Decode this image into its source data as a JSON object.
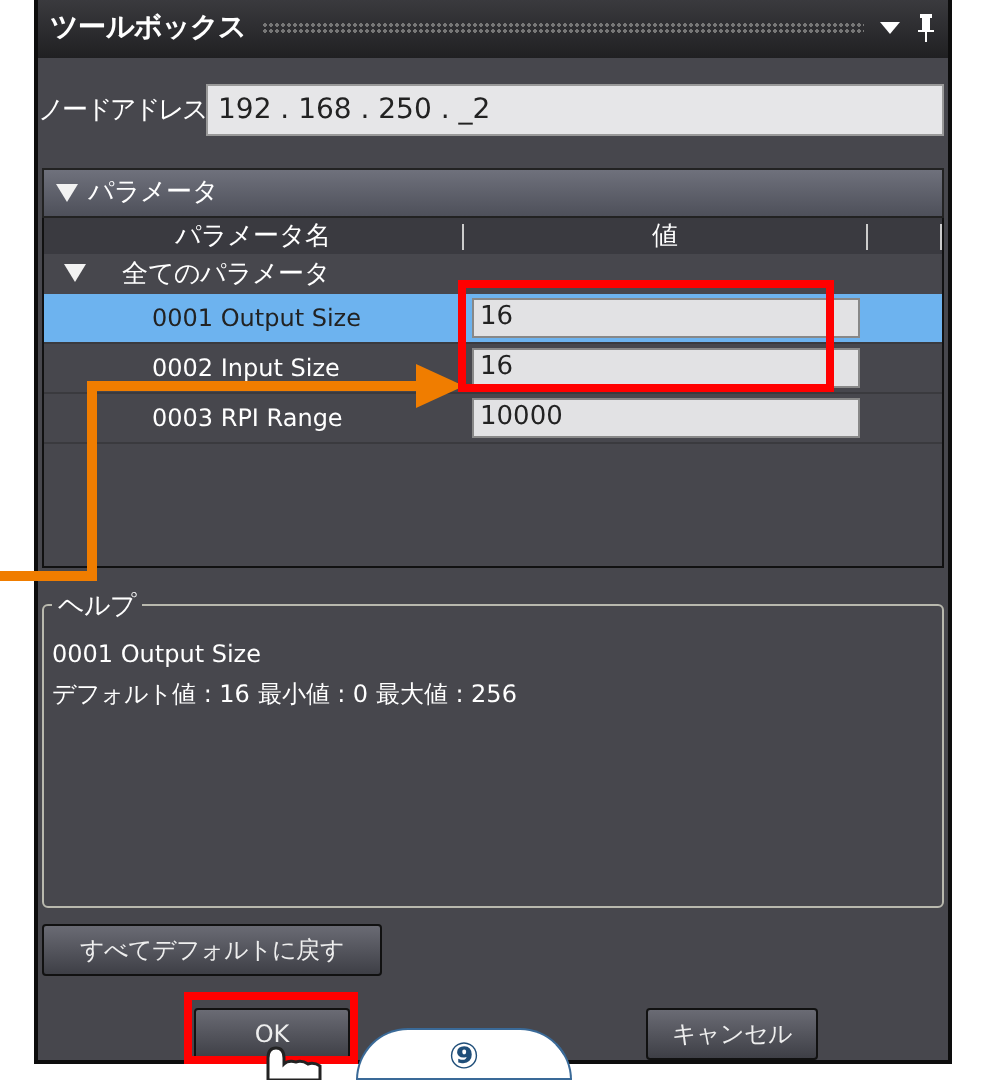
{
  "window": {
    "title": "ツールボックス"
  },
  "node_address": {
    "label": "ノードアドレス",
    "value": "192 . 168 . 250 . _2"
  },
  "parameters": {
    "title": "パラメータ",
    "expanded": true,
    "columns": [
      "パラメータ名",
      "値"
    ],
    "group": {
      "label": "全てのパラメータ",
      "expanded": true
    },
    "rows": [
      {
        "name": "0001 Output Size",
        "value": "16",
        "selected": true
      },
      {
        "name": "0002 Input Size",
        "value": "16",
        "selected": false
      },
      {
        "name": "0003 RPI Range",
        "value": "10000",
        "selected": false
      }
    ]
  },
  "help": {
    "title": "ヘルプ",
    "lines": [
      "0001 Output Size",
      "デフォルト値 : 16  最小値 : 0  最大値 : 256"
    ]
  },
  "buttons": {
    "reset": "すべてデフォルトに戻す",
    "ok": "OK",
    "cancel": "キャンセル"
  },
  "callout": {
    "text": "⑨"
  }
}
